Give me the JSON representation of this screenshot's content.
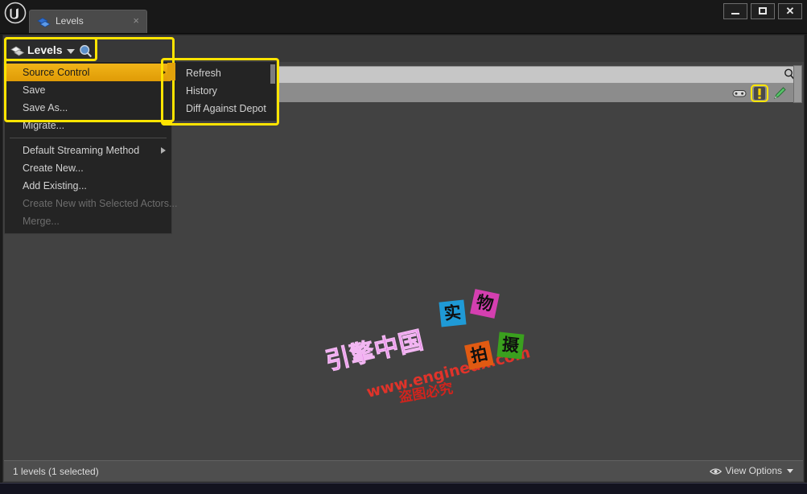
{
  "window": {
    "app_icon": "unreal-engine-logo",
    "tab": {
      "label": "Levels",
      "icon": "levels-icon",
      "close_label": "×"
    },
    "controls": {
      "minimize_label": "Minimize",
      "maximize_label": "Maximize",
      "close_label": "Close"
    }
  },
  "panel": {
    "header": {
      "title": "Levels",
      "icon": "levels-icon",
      "help_icon": "help-search-icon",
      "caret_icon": "chevron-down-icon"
    },
    "search": {
      "value": "",
      "placeholder": "",
      "icon": "search-icon"
    },
    "row_icons": [
      {
        "name": "gamepad-icon",
        "label": ""
      },
      {
        "name": "warning-exclamation-icon",
        "label": "!",
        "highlighted": true,
        "highlight_color": "#ffe400"
      },
      {
        "name": "pencil-edit-icon",
        "label": ""
      }
    ]
  },
  "menu": {
    "items": [
      {
        "label": "Source Control",
        "submenu": true,
        "highlighted": true,
        "disabled": false
      },
      {
        "label": "Save",
        "submenu": false,
        "highlighted": false,
        "disabled": false
      },
      {
        "label": "Save As...",
        "submenu": false,
        "highlighted": false,
        "disabled": false
      },
      {
        "label": "Migrate...",
        "submenu": false,
        "highlighted": false,
        "disabled": false
      },
      {
        "separator": true
      },
      {
        "label": "Default Streaming Method",
        "submenu": true,
        "highlighted": false,
        "disabled": false
      },
      {
        "label": "Create New...",
        "submenu": false,
        "highlighted": false,
        "disabled": false
      },
      {
        "label": "Add Existing...",
        "submenu": false,
        "highlighted": false,
        "disabled": false
      },
      {
        "label": "Create New with Selected Actors...",
        "submenu": false,
        "highlighted": false,
        "disabled": true
      },
      {
        "label": "Merge...",
        "submenu": false,
        "highlighted": false,
        "disabled": true
      }
    ]
  },
  "submenu": {
    "items": [
      {
        "label": "Refresh"
      },
      {
        "label": "History"
      },
      {
        "label": "Diff Against Depot"
      }
    ]
  },
  "statusbar": {
    "status_text": "1 levels (1 selected)",
    "view_options_label": "View Options",
    "view_options_icon": "eye-icon",
    "view_options_caret": "chevron-down-icon"
  },
  "watermark": {
    "title": "引擎中国",
    "url": "www.enginedx.com",
    "note": "盗图必究",
    "chips": [
      {
        "char": "实",
        "color": "#1f9ad6"
      },
      {
        "char": "物",
        "color": "#d43fb0"
      },
      {
        "char": "拍",
        "color": "#e05a12"
      },
      {
        "char": "摄",
        "color": "#3aa01e"
      }
    ]
  },
  "colors": {
    "highlight": "#ffe400",
    "menu_highlight": "#e8a80c",
    "panel_bg": "#424242",
    "menu_bg": "#242424"
  }
}
